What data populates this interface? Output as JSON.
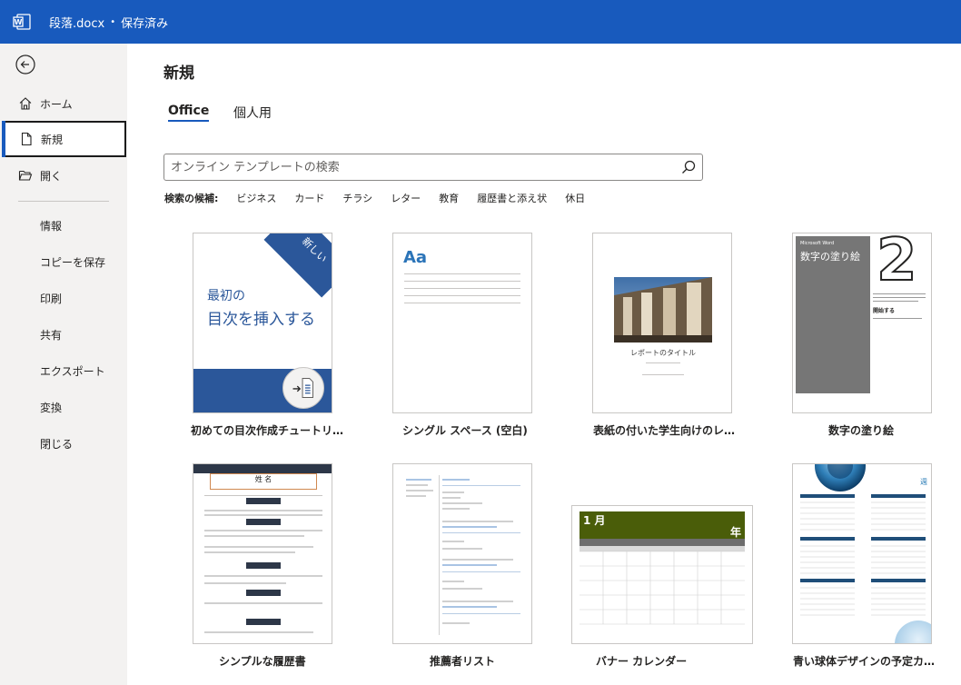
{
  "titlebar": {
    "filename": "段落.docx",
    "separator": "•",
    "status": "保存済み"
  },
  "sidebar": {
    "home": "ホーム",
    "new": "新規",
    "open": "開く",
    "sub": [
      "情報",
      "コピーを保存",
      "印刷",
      "共有",
      "エクスポート",
      "変換",
      "閉じる"
    ]
  },
  "main": {
    "title": "新規",
    "tabs": [
      "Office",
      "個人用"
    ],
    "search_placeholder": "オンライン テンプレートの検索",
    "suggest_label": "検索の候補:",
    "suggestions": [
      "ビジネス",
      "カード",
      "チラシ",
      "レター",
      "教育",
      "履歴書と添え状",
      "休日"
    ]
  },
  "templates": [
    {
      "label": "初めての目次作成チュートリ…",
      "badge": "新しい",
      "line1": "最初の",
      "line2": "目次を挿入する"
    },
    {
      "label": "シングル スペース (空白)",
      "aa": "Aa"
    },
    {
      "label": "表紙の付いた学生向けのレ…",
      "report_title": "レポートのタイトル"
    },
    {
      "label": "数字の塗り絵",
      "brand": "Microsoft Word",
      "heading": "数字の塗り絵",
      "big_num": "2",
      "start": "開始する"
    },
    {
      "label": "シンプルな履歴書",
      "name": "姓 名"
    },
    {
      "label": "推薦者リスト"
    },
    {
      "label": "バナー カレンダー",
      "month": "1 月",
      "year": "年"
    },
    {
      "label": "青い球体デザインの予定カ…",
      "week": "週"
    }
  ],
  "colors": {
    "accent": "#185abd",
    "cal_green": "#4a5d09",
    "resume_dark": "#2d3748"
  }
}
